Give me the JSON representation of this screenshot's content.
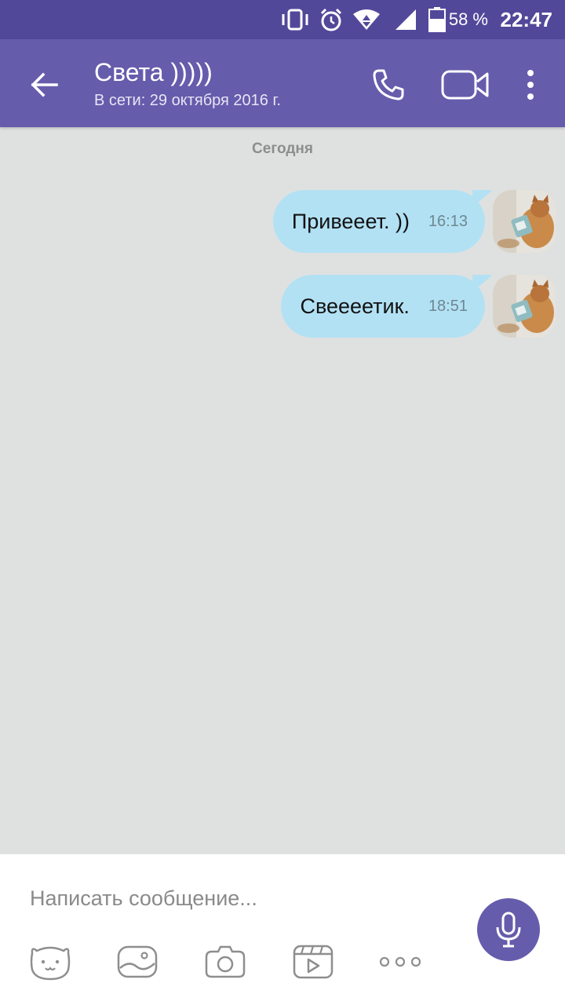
{
  "status_bar": {
    "time": "22:47",
    "battery_percent": "58 %",
    "battery_level": 0.58,
    "icons": [
      "vibrate-icon",
      "alarm-icon",
      "wifi-icon",
      "cell-signal-icon",
      "battery-icon"
    ]
  },
  "header": {
    "back_icon": "arrow-left-icon",
    "contact_name": "Света )))))",
    "status": "В сети: 29 октября 2016 г.",
    "actions": [
      "phone-icon",
      "video-camera-icon",
      "more-vertical-icon"
    ]
  },
  "chat": {
    "date_separator": "Сегодня",
    "messages": [
      {
        "text": "Привееет. ))",
        "time": "16:13",
        "direction": "outgoing"
      },
      {
        "text": "Свеееетик.",
        "time": "18:51",
        "direction": "outgoing"
      }
    ]
  },
  "composer": {
    "placeholder": "Написать сообщение...",
    "mic_icon": "microphone-icon",
    "tools": [
      "sticker-bear-icon",
      "gallery-icon",
      "camera-icon",
      "video-clip-icon",
      "more-horizontal-icon"
    ]
  },
  "colors": {
    "status_bar": "#52489a",
    "header": "#665cac",
    "chat_background": "#dfe1e0",
    "bubble": "#b2e1f4",
    "accent": "#665cac"
  }
}
